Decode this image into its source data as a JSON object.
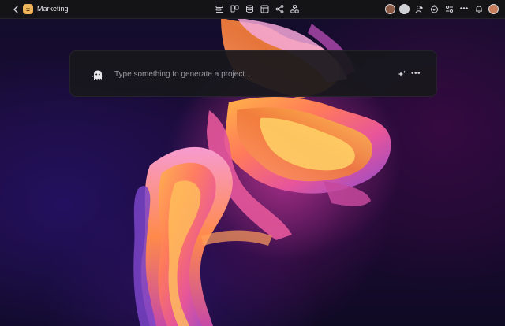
{
  "topbar": {
    "back_icon": "chevron-left-icon",
    "project_icon": "smiley-folder-icon",
    "project_name": "Marketing",
    "tools": [
      {
        "name": "list-view-icon"
      },
      {
        "name": "board-view-icon"
      },
      {
        "name": "database-icon"
      },
      {
        "name": "table-view-icon"
      },
      {
        "name": "share-nodes-icon"
      },
      {
        "name": "workflow-icon"
      }
    ],
    "right": {
      "avatars": [
        "collaborator-avatar-1",
        "collaborator-avatar-2"
      ],
      "add_user_icon": "add-user-icon",
      "timer_icon": "check-timer-icon",
      "toggle_icon": "toggle-settings-icon",
      "more_label": "•••",
      "bell_icon": "bell-icon",
      "user_avatar": "current-user-avatar"
    }
  },
  "prompt": {
    "icon": "ghost-icon",
    "placeholder": "Type something to generate a project...",
    "value": "",
    "sparkle_icon": "sparkle-icon",
    "more_label": "•••"
  },
  "colors": {
    "topbar_bg": "#141416",
    "card_bg": "#18181c",
    "accent_orange": "#f0b45a",
    "accent_pink": "#e85a9a",
    "accent_purple": "#6a3aa8"
  }
}
